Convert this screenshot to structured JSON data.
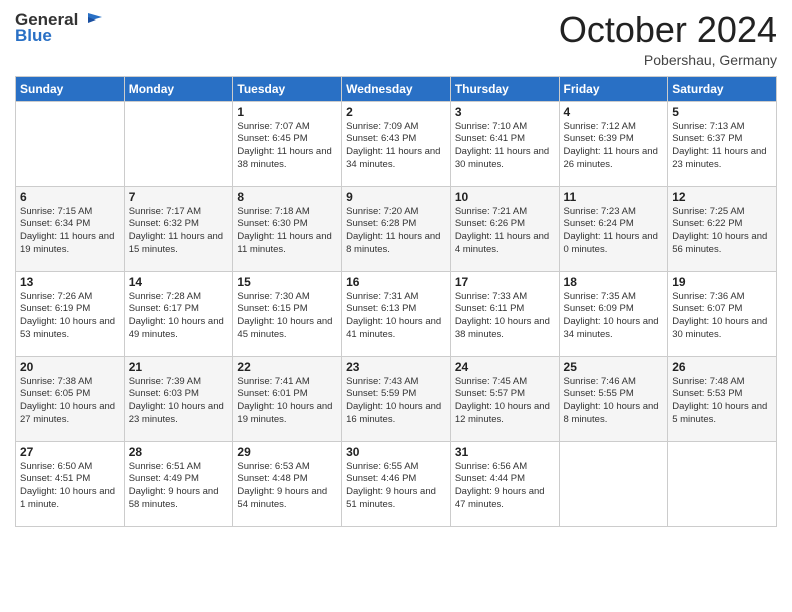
{
  "header": {
    "logo_general": "General",
    "logo_blue": "Blue",
    "month_title": "October 2024",
    "subtitle": "Pobershau, Germany"
  },
  "days_of_week": [
    "Sunday",
    "Monday",
    "Tuesday",
    "Wednesday",
    "Thursday",
    "Friday",
    "Saturday"
  ],
  "weeks": [
    [
      {
        "num": "",
        "sunrise": "",
        "sunset": "",
        "daylight": ""
      },
      {
        "num": "",
        "sunrise": "",
        "sunset": "",
        "daylight": ""
      },
      {
        "num": "1",
        "sunrise": "Sunrise: 7:07 AM",
        "sunset": "Sunset: 6:45 PM",
        "daylight": "Daylight: 11 hours and 38 minutes."
      },
      {
        "num": "2",
        "sunrise": "Sunrise: 7:09 AM",
        "sunset": "Sunset: 6:43 PM",
        "daylight": "Daylight: 11 hours and 34 minutes."
      },
      {
        "num": "3",
        "sunrise": "Sunrise: 7:10 AM",
        "sunset": "Sunset: 6:41 PM",
        "daylight": "Daylight: 11 hours and 30 minutes."
      },
      {
        "num": "4",
        "sunrise": "Sunrise: 7:12 AM",
        "sunset": "Sunset: 6:39 PM",
        "daylight": "Daylight: 11 hours and 26 minutes."
      },
      {
        "num": "5",
        "sunrise": "Sunrise: 7:13 AM",
        "sunset": "Sunset: 6:37 PM",
        "daylight": "Daylight: 11 hours and 23 minutes."
      }
    ],
    [
      {
        "num": "6",
        "sunrise": "Sunrise: 7:15 AM",
        "sunset": "Sunset: 6:34 PM",
        "daylight": "Daylight: 11 hours and 19 minutes."
      },
      {
        "num": "7",
        "sunrise": "Sunrise: 7:17 AM",
        "sunset": "Sunset: 6:32 PM",
        "daylight": "Daylight: 11 hours and 15 minutes."
      },
      {
        "num": "8",
        "sunrise": "Sunrise: 7:18 AM",
        "sunset": "Sunset: 6:30 PM",
        "daylight": "Daylight: 11 hours and 11 minutes."
      },
      {
        "num": "9",
        "sunrise": "Sunrise: 7:20 AM",
        "sunset": "Sunset: 6:28 PM",
        "daylight": "Daylight: 11 hours and 8 minutes."
      },
      {
        "num": "10",
        "sunrise": "Sunrise: 7:21 AM",
        "sunset": "Sunset: 6:26 PM",
        "daylight": "Daylight: 11 hours and 4 minutes."
      },
      {
        "num": "11",
        "sunrise": "Sunrise: 7:23 AM",
        "sunset": "Sunset: 6:24 PM",
        "daylight": "Daylight: 11 hours and 0 minutes."
      },
      {
        "num": "12",
        "sunrise": "Sunrise: 7:25 AM",
        "sunset": "Sunset: 6:22 PM",
        "daylight": "Daylight: 10 hours and 56 minutes."
      }
    ],
    [
      {
        "num": "13",
        "sunrise": "Sunrise: 7:26 AM",
        "sunset": "Sunset: 6:19 PM",
        "daylight": "Daylight: 10 hours and 53 minutes."
      },
      {
        "num": "14",
        "sunrise": "Sunrise: 7:28 AM",
        "sunset": "Sunset: 6:17 PM",
        "daylight": "Daylight: 10 hours and 49 minutes."
      },
      {
        "num": "15",
        "sunrise": "Sunrise: 7:30 AM",
        "sunset": "Sunset: 6:15 PM",
        "daylight": "Daylight: 10 hours and 45 minutes."
      },
      {
        "num": "16",
        "sunrise": "Sunrise: 7:31 AM",
        "sunset": "Sunset: 6:13 PM",
        "daylight": "Daylight: 10 hours and 41 minutes."
      },
      {
        "num": "17",
        "sunrise": "Sunrise: 7:33 AM",
        "sunset": "Sunset: 6:11 PM",
        "daylight": "Daylight: 10 hours and 38 minutes."
      },
      {
        "num": "18",
        "sunrise": "Sunrise: 7:35 AM",
        "sunset": "Sunset: 6:09 PM",
        "daylight": "Daylight: 10 hours and 34 minutes."
      },
      {
        "num": "19",
        "sunrise": "Sunrise: 7:36 AM",
        "sunset": "Sunset: 6:07 PM",
        "daylight": "Daylight: 10 hours and 30 minutes."
      }
    ],
    [
      {
        "num": "20",
        "sunrise": "Sunrise: 7:38 AM",
        "sunset": "Sunset: 6:05 PM",
        "daylight": "Daylight: 10 hours and 27 minutes."
      },
      {
        "num": "21",
        "sunrise": "Sunrise: 7:39 AM",
        "sunset": "Sunset: 6:03 PM",
        "daylight": "Daylight: 10 hours and 23 minutes."
      },
      {
        "num": "22",
        "sunrise": "Sunrise: 7:41 AM",
        "sunset": "Sunset: 6:01 PM",
        "daylight": "Daylight: 10 hours and 19 minutes."
      },
      {
        "num": "23",
        "sunrise": "Sunrise: 7:43 AM",
        "sunset": "Sunset: 5:59 PM",
        "daylight": "Daylight: 10 hours and 16 minutes."
      },
      {
        "num": "24",
        "sunrise": "Sunrise: 7:45 AM",
        "sunset": "Sunset: 5:57 PM",
        "daylight": "Daylight: 10 hours and 12 minutes."
      },
      {
        "num": "25",
        "sunrise": "Sunrise: 7:46 AM",
        "sunset": "Sunset: 5:55 PM",
        "daylight": "Daylight: 10 hours and 8 minutes."
      },
      {
        "num": "26",
        "sunrise": "Sunrise: 7:48 AM",
        "sunset": "Sunset: 5:53 PM",
        "daylight": "Daylight: 10 hours and 5 minutes."
      }
    ],
    [
      {
        "num": "27",
        "sunrise": "Sunrise: 6:50 AM",
        "sunset": "Sunset: 4:51 PM",
        "daylight": "Daylight: 10 hours and 1 minute."
      },
      {
        "num": "28",
        "sunrise": "Sunrise: 6:51 AM",
        "sunset": "Sunset: 4:49 PM",
        "daylight": "Daylight: 9 hours and 58 minutes."
      },
      {
        "num": "29",
        "sunrise": "Sunrise: 6:53 AM",
        "sunset": "Sunset: 4:48 PM",
        "daylight": "Daylight: 9 hours and 54 minutes."
      },
      {
        "num": "30",
        "sunrise": "Sunrise: 6:55 AM",
        "sunset": "Sunset: 4:46 PM",
        "daylight": "Daylight: 9 hours and 51 minutes."
      },
      {
        "num": "31",
        "sunrise": "Sunrise: 6:56 AM",
        "sunset": "Sunset: 4:44 PM",
        "daylight": "Daylight: 9 hours and 47 minutes."
      },
      {
        "num": "",
        "sunrise": "",
        "sunset": "",
        "daylight": ""
      },
      {
        "num": "",
        "sunrise": "",
        "sunset": "",
        "daylight": ""
      }
    ]
  ]
}
